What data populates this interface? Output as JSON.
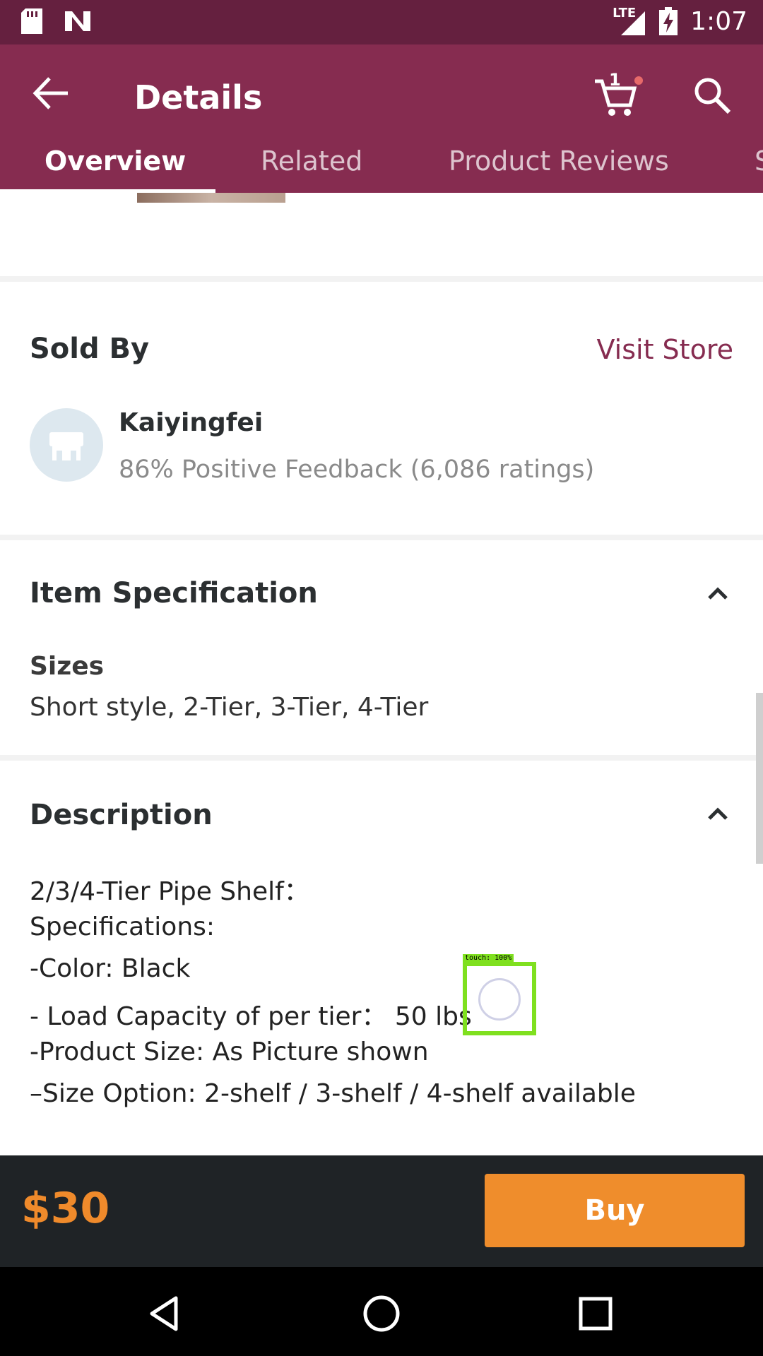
{
  "status": {
    "time": "1:07",
    "network": "LTE"
  },
  "app_bar": {
    "title": "Details",
    "cart_count": "1",
    "tabs": [
      {
        "label": "Overview"
      },
      {
        "label": "Related"
      },
      {
        "label": "Product Reviews"
      },
      {
        "label": "S"
      }
    ]
  },
  "sold_by": {
    "heading": "Sold By",
    "visit_store": "Visit Store",
    "store_name": "Kaiyingfei",
    "feedback": "86% Positive Feedback (6,086 ratings)"
  },
  "item_spec": {
    "heading": "Item Specification",
    "label": "Sizes",
    "value": "Short style, 2-Tier, 3-Tier, 4-Tier"
  },
  "description": {
    "heading": "Description",
    "lines": [
      "2/3/4-Tier Pipe Shelf：",
      "Specifications:",
      "-Color: Black",
      "- Load Capacity of per tier：  50 lbs",
      "-Product Size: As Picture shown",
      "–Size Option: 2-shelf / 3-shelf / 4-shelf  available"
    ]
  },
  "touch_overlay": {
    "label": "touch: 100%"
  },
  "bottom_bar": {
    "price": "$30",
    "buy_label": "Buy"
  },
  "colors": {
    "primary": "#862c50",
    "status_bar": "#65203f",
    "accent": "#ef8d2c",
    "bottom_bar": "#1f2326"
  },
  "icons": {
    "back": "arrow-left-icon",
    "cart": "cart-icon",
    "search": "search-icon",
    "store": "store-icon",
    "collapse": "chevron-up-icon",
    "nav_back": "triangle-back-icon",
    "nav_home": "circle-home-icon",
    "nav_recents": "square-recents-icon"
  }
}
